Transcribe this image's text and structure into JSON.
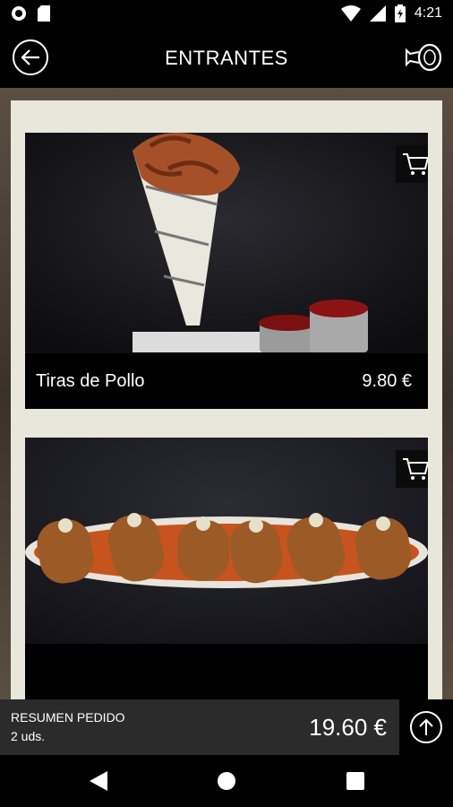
{
  "status_bar": {
    "time": "4:21"
  },
  "app_bar": {
    "title": "ENTRANTES"
  },
  "products": [
    {
      "name": "Tiras de Pollo",
      "price": "9.80 €"
    },
    {
      "name": "",
      "price": ""
    }
  ],
  "order_summary": {
    "label": "RESUMEN PEDIDO",
    "units": "2 uds.",
    "total": "19.60 €"
  },
  "icons": {
    "back": "arrow-left-circle-icon",
    "menu": "ham-leg-icon",
    "cart": "shopping-cart-icon",
    "scroll_top": "arrow-up-circle-icon"
  },
  "colors": {
    "panel_bg": "#e9e6dc",
    "app_bar": "#000000",
    "order_bar": "#2b2b2b"
  }
}
